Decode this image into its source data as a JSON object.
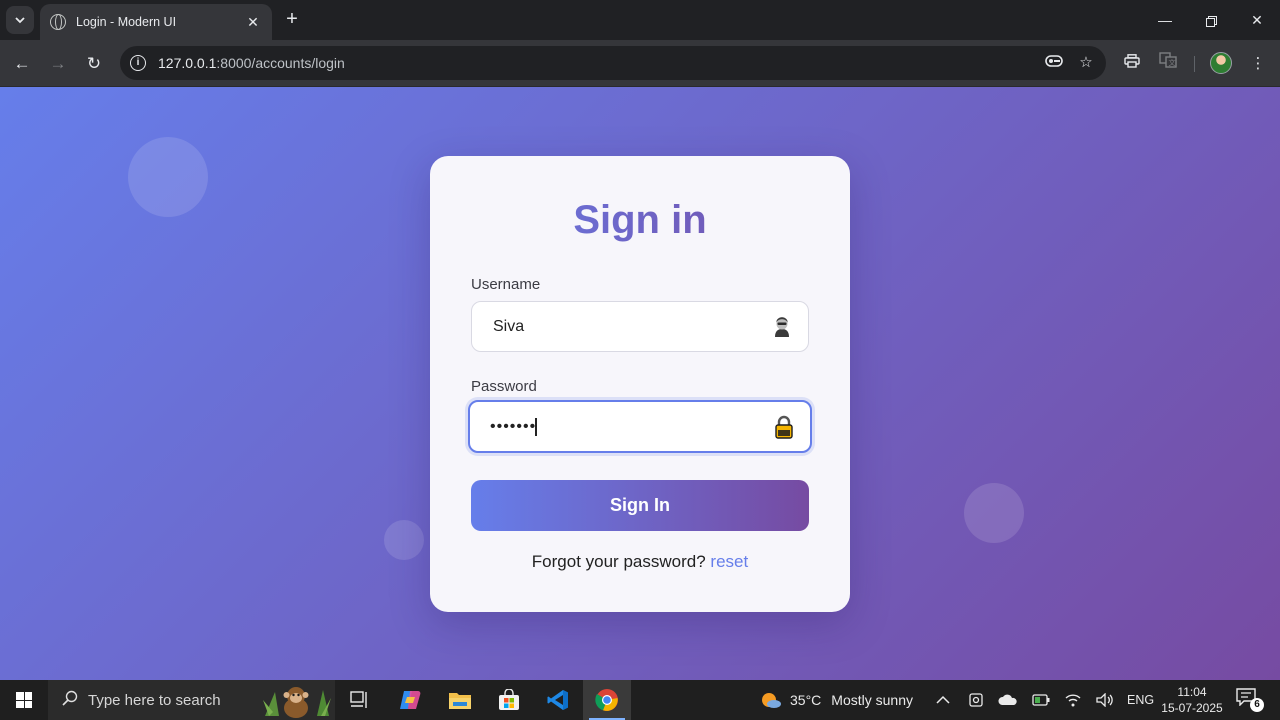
{
  "browser": {
    "tab_title": "Login - Modern UI",
    "url_host": "127.0.0.1",
    "url_path": ":8000/accounts/login"
  },
  "page": {
    "title": "Sign in",
    "username_label": "Username",
    "username_value": "Siva",
    "password_label": "Password",
    "password_value": "password",
    "submit_label": "Sign In",
    "forgot_text": "Forgot your password?",
    "reset_link": "reset"
  },
  "taskbar": {
    "search_placeholder": "Type here to search",
    "temperature": "35°C",
    "weather": "Mostly sunny",
    "language": "ENG",
    "time": "11:04",
    "date": "15-07-2025",
    "notification_count": "6"
  },
  "colors": {
    "gradient_start": "#667eea",
    "gradient_end": "#764ba2",
    "link": "#667eea"
  },
  "icons": [
    "tab-search-icon",
    "globe-icon",
    "close-icon",
    "plus-icon",
    "minimize-icon",
    "restore-icon",
    "back-icon",
    "forward-icon",
    "reload-icon",
    "info-icon",
    "password-key-icon",
    "star-icon",
    "print-icon",
    "translate-icon",
    "profile-avatar",
    "menu-icon",
    "user-icon",
    "lock-icon",
    "windows-icon",
    "search-icon"
  ]
}
